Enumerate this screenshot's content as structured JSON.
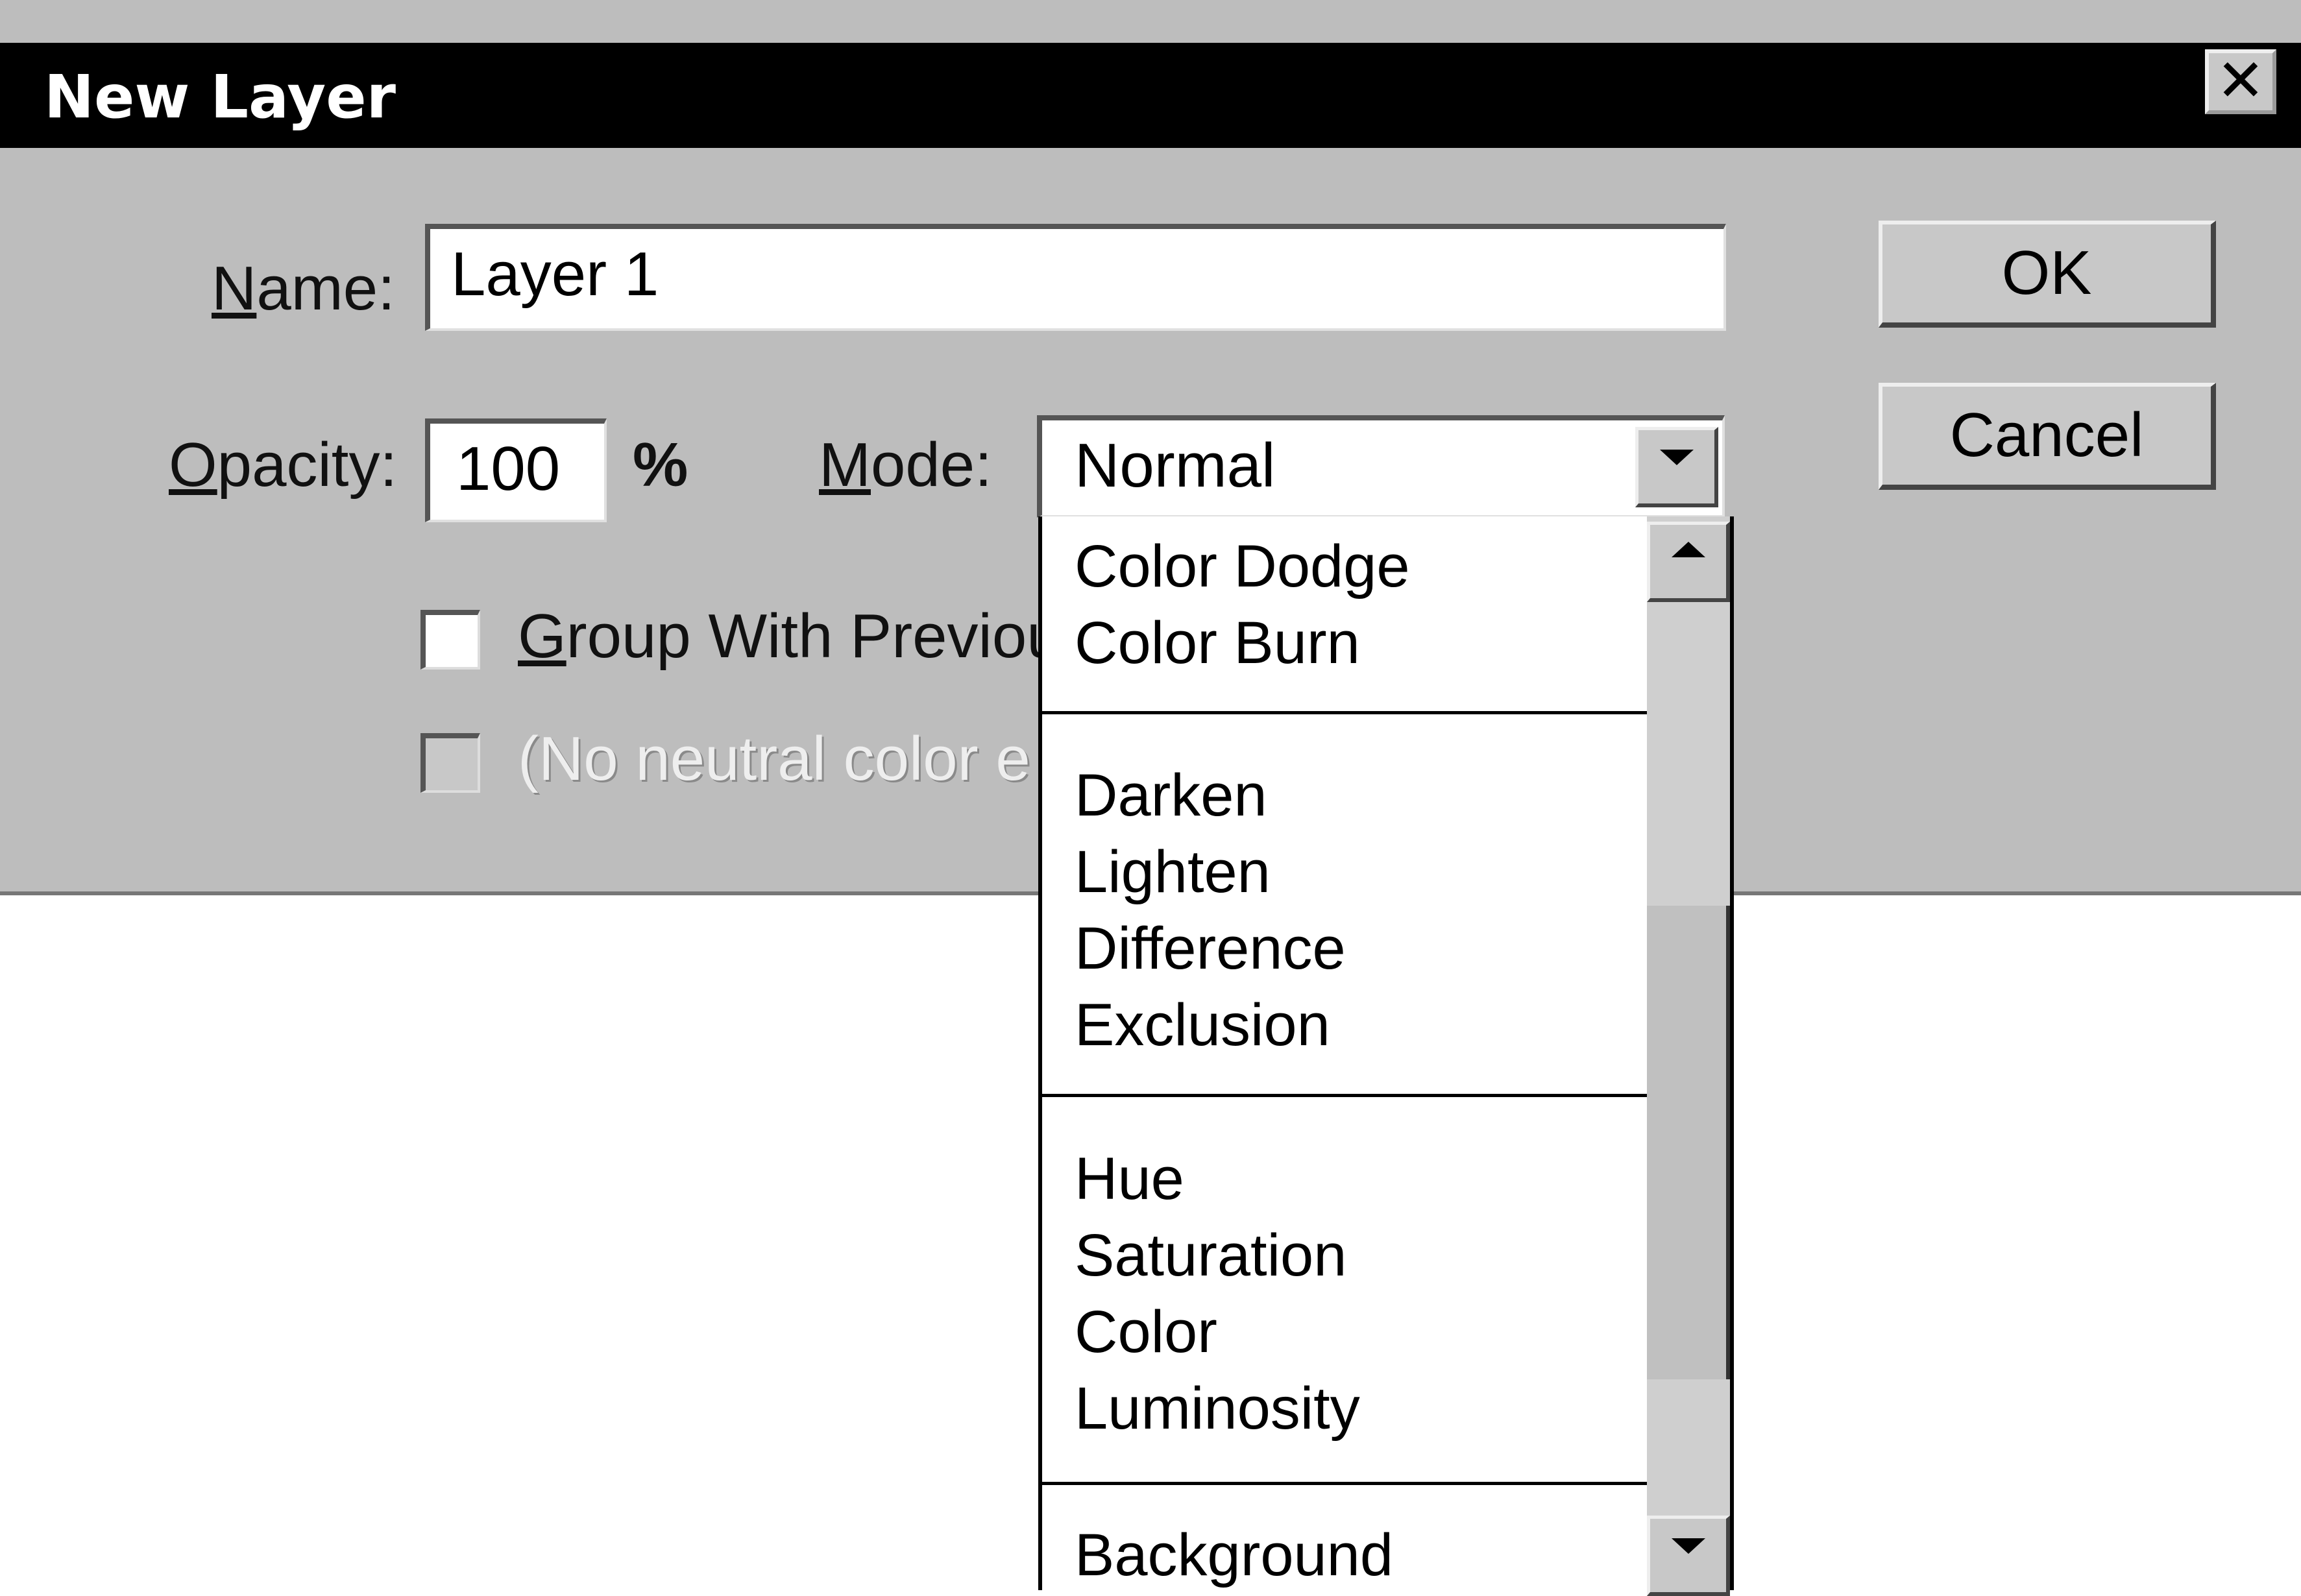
{
  "dialog": {
    "title": "New Layer",
    "close_label": "✕"
  },
  "name_field": {
    "label_prefix": "N",
    "label_rest": "ame:",
    "value": "Layer 1"
  },
  "opacity_field": {
    "label_prefix": "O",
    "label_rest": "pacity:",
    "value": "100",
    "unit": "%"
  },
  "mode": {
    "label_prefix": "M",
    "label_rest": "ode:",
    "selected": "Normal",
    "options": {
      "group1": [
        "Color Dodge",
        "Color Burn"
      ],
      "group2": [
        "Darken",
        "Lighten",
        "Difference",
        "Exclusion"
      ],
      "group3": [
        "Hue",
        "Saturation",
        "Color",
        "Luminosity"
      ],
      "group4": [
        "Background"
      ]
    }
  },
  "checkboxes": {
    "group_prefix": "G",
    "group_rest": "roup With Previou",
    "neutral_label": "(No neutral color e"
  },
  "buttons": {
    "ok": "OK",
    "cancel": "Cancel"
  }
}
